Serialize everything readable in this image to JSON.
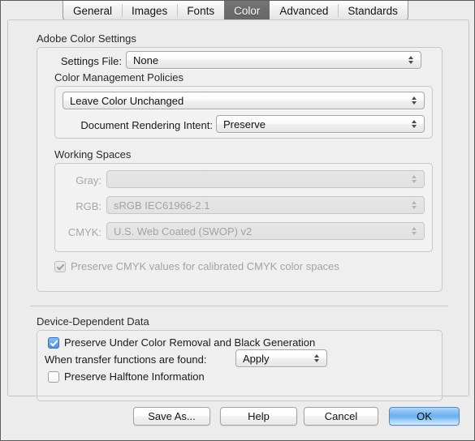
{
  "tabs": [
    {
      "label": "General",
      "selected": false
    },
    {
      "label": "Images",
      "selected": false
    },
    {
      "label": "Fonts",
      "selected": false
    },
    {
      "label": "Color",
      "selected": true
    },
    {
      "label": "Advanced",
      "selected": false
    },
    {
      "label": "Standards",
      "selected": false
    }
  ],
  "adobe_color_settings": {
    "title": "Adobe Color Settings",
    "settings_file": {
      "label": "Settings File:",
      "value": "None"
    },
    "color_management_policies": {
      "title": "Color Management Policies",
      "policy": {
        "value": "Leave Color Unchanged"
      },
      "rendering_intent": {
        "label": "Document Rendering Intent:",
        "value": "Preserve"
      }
    },
    "working_spaces": {
      "title": "Working Spaces",
      "gray": {
        "label": "Gray:",
        "value": ""
      },
      "rgb": {
        "label": "RGB:",
        "value": "sRGB IEC61966-2.1"
      },
      "cmyk": {
        "label": "CMYK:",
        "value": "U.S. Web Coated (SWOP) v2"
      }
    },
    "preserve_cmyk": {
      "label": "Preserve CMYK values for calibrated CMYK color spaces"
    }
  },
  "device_dependent_data": {
    "title": "Device-Dependent Data",
    "preserve_ucr": {
      "label": "Preserve Under Color Removal and Black Generation"
    },
    "transfer_functions": {
      "label": "When transfer functions are found:",
      "value": "Apply"
    },
    "preserve_halftone": {
      "label": "Preserve Halftone Information"
    }
  },
  "buttons": {
    "save_as": "Save As...",
    "help": "Help",
    "cancel": "Cancel",
    "ok": "OK"
  },
  "colors": {
    "window_background": "#ececec",
    "selected_tab": "#6c6c6c",
    "checkbox_accent": "#4e93e0",
    "default_button": "#69aeef"
  }
}
